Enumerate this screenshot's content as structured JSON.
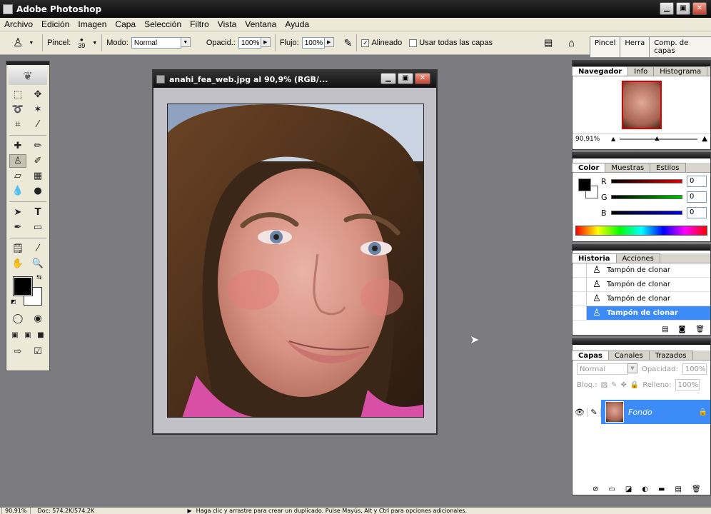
{
  "window": {
    "title": "Adobe Photoshop",
    "min": "▁",
    "max": "▣",
    "close": "✕"
  },
  "menu": [
    "Archivo",
    "Edición",
    "Imagen",
    "Capa",
    "Selección",
    "Filtro",
    "Vista",
    "Ventana",
    "Ayuda"
  ],
  "options": {
    "pincel_label": "Pincel:",
    "brush_size": "39",
    "modo_label": "Modo:",
    "modo_value": "Normal",
    "opacidad_label": "Opacid.:",
    "opacidad_value": "100%",
    "flujo_label": "Flujo:",
    "flujo_value": "100%",
    "alineado_label": "Alineado",
    "alineado_checked": true,
    "usar_capas_label": "Usar todas las capas",
    "usar_capas_checked": false
  },
  "panel_well_tabs": [
    "Pincel",
    "Herra",
    "Comp. de capas"
  ],
  "document": {
    "title": "anahi_fea_web.jpg al 90,9% (RGB/..."
  },
  "navigator": {
    "tabs": [
      "Navegador",
      "Info",
      "Histograma"
    ],
    "zoom": "90,91%",
    "zoom_level": 0.45
  },
  "color": {
    "tabs": [
      "Color",
      "Muestras",
      "Estilos"
    ],
    "channels": [
      {
        "label": "R",
        "value": "0",
        "color": "#e00000"
      },
      {
        "label": "G",
        "value": "0",
        "color": "#00c000"
      },
      {
        "label": "B",
        "value": "0",
        "color": "#0000e0"
      }
    ]
  },
  "history": {
    "tabs": [
      "Historia",
      "Acciones"
    ],
    "items": [
      "Tampón de clonar",
      "Tampón de clonar",
      "Tampón de clonar",
      "Tampón de clonar"
    ],
    "selected_index": 3
  },
  "layers": {
    "tabs": [
      "Capas",
      "Canales",
      "Trazados"
    ],
    "blend_mode": "Normal",
    "opacidad_label": "Opacidad:",
    "opacidad_value": "100%",
    "bloq_label": "Bloq.:",
    "relleno_label": "Relleno:",
    "relleno_value": "100%",
    "layer_name": "Fondo"
  },
  "status": {
    "zoom": "90,91%",
    "doc": "Doc: 574,2K/574,2K",
    "hint": "Haga clic y arrastre para crear un duplicado. Pulse Mayús, Alt y Ctrl para opciones adicionales."
  },
  "accent": "#3d8bf7"
}
